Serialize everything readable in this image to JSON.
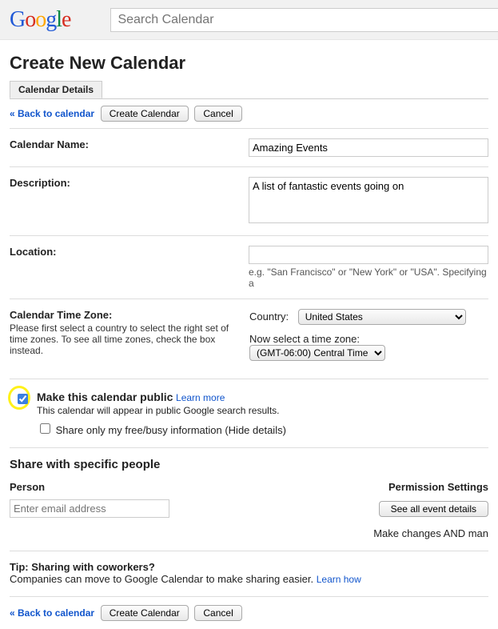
{
  "search": {
    "placeholder": "Search Calendar"
  },
  "page_title": "Create New Calendar",
  "tab": "Calendar Details",
  "back_link": "« Back to calendar",
  "create_btn": "Create Calendar",
  "cancel_btn": "Cancel",
  "fields": {
    "name_label": "Calendar Name:",
    "name_value": "Amazing Events",
    "desc_label": "Description:",
    "desc_value": "A list of fantastic events going on",
    "loc_label": "Location:",
    "loc_value": "",
    "loc_hint": "e.g. \"San Francisco\" or \"New York\" or \"USA\". Specifying a",
    "tz_label": "Calendar Time Zone:",
    "tz_sub": "Please first select a country to select the right set of time zones. To see all time zones, check the box instead.",
    "country_label": "Country:",
    "country_value": "United States",
    "tz_select_label": "Now select a time zone:",
    "tz_value": "(GMT-06:00) Central Time"
  },
  "public": {
    "title": "Make this calendar public",
    "learn": "Learn more",
    "sub": "This calendar will appear in public Google search results.",
    "freebusy": "Share only my free/busy information (Hide details)"
  },
  "share": {
    "title": "Share with specific people",
    "person": "Person",
    "perm": "Permission Settings",
    "email_ph": "Enter email address",
    "perm_btn": "See all event details",
    "note": "Make changes AND man"
  },
  "tip": {
    "title": "Tip: Sharing with coworkers?",
    "body": "Companies can move to Google Calendar to make sharing easier. ",
    "link": "Learn how"
  }
}
